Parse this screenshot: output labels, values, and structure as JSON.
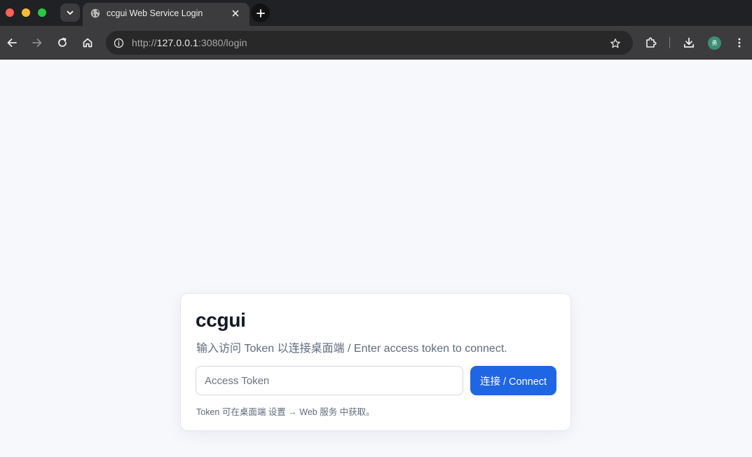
{
  "browser": {
    "tab": {
      "title": "ccgui Web Service Login",
      "favicon": "globe-icon"
    },
    "url": {
      "scheme": "http://",
      "host": "127.0.0.1",
      "rest": ":3080/login"
    },
    "avatar_initial": "勇",
    "avatar_color": "#3b8e74",
    "icons": [
      "tab-search-icon",
      "globe-icon",
      "close-icon",
      "plus-icon",
      "back-arrow-icon",
      "forward-arrow-icon",
      "reload-icon",
      "home-icon",
      "site-info-icon",
      "star-icon",
      "extensions-icon",
      "download-icon",
      "more-vert-icon"
    ]
  },
  "login": {
    "title": "ccgui",
    "subtitle": "输入访问 Token 以连接桌面端 / Enter access token to connect.",
    "input_placeholder": "Access Token",
    "input_value": "",
    "button_label": "连接 / Connect",
    "hint": "Token 可在桌面端 设置 → Web 服务 中获取。"
  },
  "colors": {
    "accent": "#1f66e5",
    "page_background": "#f7f8fc",
    "title_text": "#111827",
    "muted_text": "#5f6b7c"
  }
}
